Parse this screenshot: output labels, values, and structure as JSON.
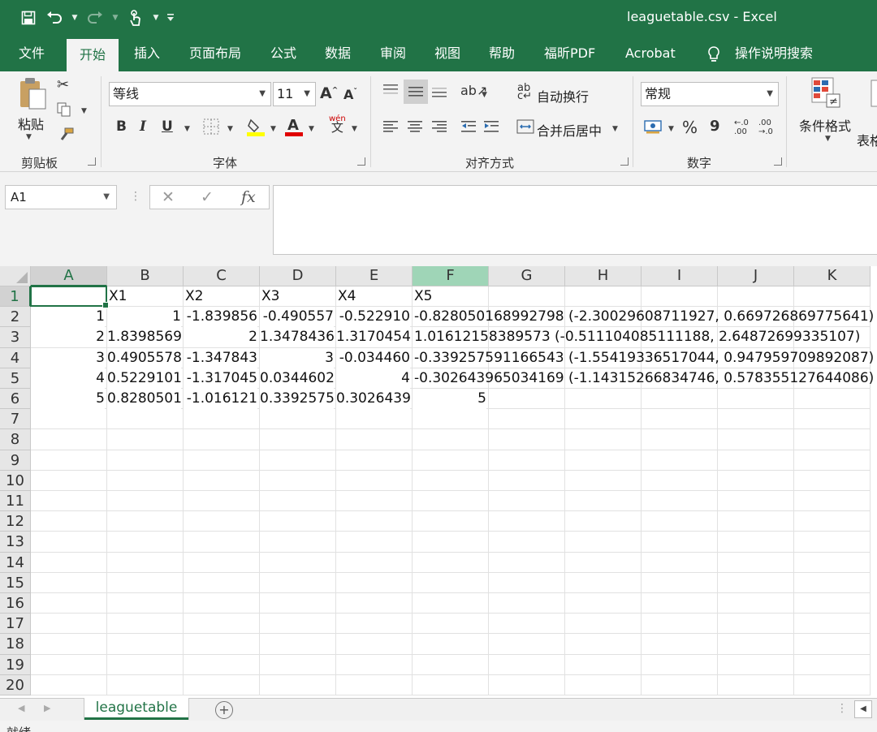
{
  "window": {
    "title": "leaguetable.csv  -  Excel"
  },
  "quick_access": [
    "save-icon",
    "undo-icon",
    "redo-icon",
    "touch-mode-icon",
    "customize-icon"
  ],
  "tabs": [
    "文件",
    "开始",
    "插入",
    "页面布局",
    "公式",
    "数据",
    "审阅",
    "视图",
    "帮助",
    "福昕PDF",
    "Acrobat",
    "操作说明搜索"
  ],
  "active_tab": "开始",
  "ribbon": {
    "clipboard": {
      "paste_label": "粘贴",
      "group_label": "剪贴板"
    },
    "font": {
      "font_name": "等线",
      "font_size": "11",
      "group_label": "字体",
      "bold": "B",
      "italic": "I",
      "underline": "U",
      "wen": "wén",
      "wen2": "文"
    },
    "alignment": {
      "wrap_text": "自动换行",
      "merge_center": "合并后居中",
      "group_label": "对齐方式"
    },
    "number": {
      "format": "常规",
      "percent": "%",
      "comma": "9",
      "group_label": "数字"
    },
    "styles": {
      "conditional_format": "条件格式",
      "table_partial": "表格"
    }
  },
  "formula_bar": {
    "name_box": "A1",
    "cancel": "✕",
    "enter": "✓",
    "fx": "fx",
    "content": ""
  },
  "columns": [
    "A",
    "B",
    "C",
    "D",
    "E",
    "F",
    "G",
    "H",
    "I",
    "J",
    "K"
  ],
  "rows": [
    "1",
    "2",
    "3",
    "4",
    "5",
    "6",
    "7",
    "8",
    "9",
    "10",
    "11",
    "12",
    "13",
    "14",
    "15",
    "16",
    "17",
    "18",
    "19",
    "20"
  ],
  "cells": {
    "row1": [
      "",
      "X1",
      "X2",
      "X3",
      "X4",
      "X5"
    ],
    "row2": [
      "1",
      "1",
      "-1.839856",
      "-0.490557",
      "-0.522910",
      "-0.828050168992798 (-2.30029608711927, 0.669726869775641)"
    ],
    "row3": [
      "2",
      "1.8398569",
      "2",
      "1.3478436",
      "1.3170454",
      "1.01612158389573 (-0.511104085111188, 2.64872699335107)"
    ],
    "row4": [
      "3",
      "0.4905578",
      "-1.347843",
      "3",
      "-0.034460",
      "-0.339257591166543 (-1.55419336517044, 0.947959709892087)"
    ],
    "row5": [
      "4",
      "0.5229101",
      "-1.317045",
      "0.0344602",
      "4",
      "-0.302643965034169 (-1.14315266834746, 0.578355127644086)"
    ],
    "row6": [
      "5",
      "0.8280501",
      "-1.016121",
      "0.3392575",
      "0.3026439",
      "5"
    ]
  },
  "sheet_tab": "leaguetable",
  "status": "就绪",
  "colors": {
    "accent": "#217346",
    "ribbon_bg": "#f3f3f3"
  }
}
